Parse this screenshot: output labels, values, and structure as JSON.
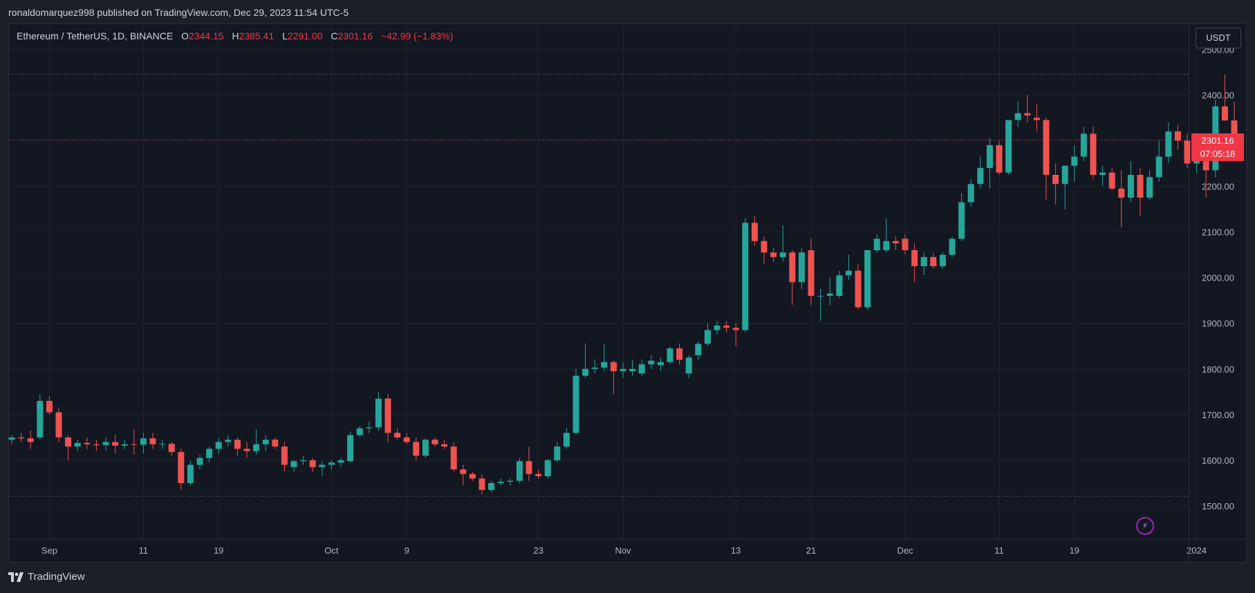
{
  "header": {
    "publisher_line": "ronaldomarquez998 published on TradingView.com, Dec 29, 2023 11:54 UTC-5"
  },
  "symbol": {
    "name": "Ethereum / TetherUS, 1D, BINANCE",
    "open_label": "O",
    "open": "2344.15",
    "high_label": "H",
    "high": "2385.41",
    "low_label": "L",
    "low": "2291.00",
    "close_label": "C",
    "close": "2301.16",
    "change": "−42.99 (−1.83%)"
  },
  "currency_button": {
    "label": "USDT"
  },
  "last_price": {
    "value": "2301.16",
    "countdown": "07:05:18"
  },
  "footer": {
    "brand": "TradingView"
  },
  "icons": {
    "logo": "tradingview-logo-icon",
    "alert": "lightning-bolt-icon"
  },
  "colors": {
    "up": "#26a69a",
    "down": "#ef5350",
    "background": "#131722",
    "grid": "#1e222d",
    "last_price": "#f23645"
  },
  "chart_data": {
    "type": "candlestick",
    "title": "Ethereum / TetherUS, 1D, BINANCE",
    "ylim": [
      1435,
      2510
    ],
    "y_ticks": [
      1500,
      1600,
      1700,
      1800,
      1900,
      2000,
      2100,
      2200,
      2300,
      2400,
      2500
    ],
    "y_tick_labels": [
      "1500.00",
      "1600.00",
      "1700.00",
      "1800.00",
      "1900.00",
      "2000.00",
      "2100.00",
      "2200.00",
      "2300.00",
      "2400.00",
      "2500.00"
    ],
    "x_tick_labels": [
      {
        "label": "Sep",
        "date": "2023-09-01"
      },
      {
        "label": "11",
        "date": "2023-09-11"
      },
      {
        "label": "19",
        "date": "2023-09-19"
      },
      {
        "label": "Oct",
        "date": "2023-10-01"
      },
      {
        "label": "9",
        "date": "2023-10-09"
      },
      {
        "label": "23",
        "date": "2023-10-23"
      },
      {
        "label": "Nov",
        "date": "2023-11-01"
      },
      {
        "label": "13",
        "date": "2023-11-13"
      },
      {
        "label": "21",
        "date": "2023-11-21"
      },
      {
        "label": "Dec",
        "date": "2023-12-01"
      },
      {
        "label": "11",
        "date": "2023-12-11"
      },
      {
        "label": "19",
        "date": "2023-12-19"
      },
      {
        "label": "2024",
        "date": "2024-01-01"
      }
    ],
    "grid": true,
    "horizontal_levels": [
      2445,
      2301.16,
      1521
    ],
    "ohlc": [
      {
        "date": "2023-08-28",
        "o": 1645,
        "h": 1655,
        "l": 1635,
        "c": 1650
      },
      {
        "date": "2023-08-29",
        "o": 1650,
        "h": 1660,
        "l": 1640,
        "c": 1648
      },
      {
        "date": "2023-08-30",
        "o": 1648,
        "h": 1665,
        "l": 1625,
        "c": 1640
      },
      {
        "date": "2023-08-31",
        "o": 1650,
        "h": 1745,
        "l": 1645,
        "c": 1730
      },
      {
        "date": "2023-09-01",
        "o": 1730,
        "h": 1740,
        "l": 1700,
        "c": 1705
      },
      {
        "date": "2023-09-02",
        "o": 1705,
        "h": 1715,
        "l": 1640,
        "c": 1650
      },
      {
        "date": "2023-09-03",
        "o": 1650,
        "h": 1655,
        "l": 1600,
        "c": 1630
      },
      {
        "date": "2023-09-04",
        "o": 1630,
        "h": 1645,
        "l": 1620,
        "c": 1638
      },
      {
        "date": "2023-09-05",
        "o": 1638,
        "h": 1650,
        "l": 1625,
        "c": 1635
      },
      {
        "date": "2023-09-06",
        "o": 1635,
        "h": 1645,
        "l": 1620,
        "c": 1633
      },
      {
        "date": "2023-09-07",
        "o": 1633,
        "h": 1650,
        "l": 1620,
        "c": 1640
      },
      {
        "date": "2023-09-08",
        "o": 1640,
        "h": 1655,
        "l": 1615,
        "c": 1632
      },
      {
        "date": "2023-09-09",
        "o": 1632,
        "h": 1645,
        "l": 1625,
        "c": 1635
      },
      {
        "date": "2023-09-10",
        "o": 1635,
        "h": 1668,
        "l": 1612,
        "c": 1634
      },
      {
        "date": "2023-09-11",
        "o": 1634,
        "h": 1660,
        "l": 1615,
        "c": 1648
      },
      {
        "date": "2023-09-12",
        "o": 1648,
        "h": 1660,
        "l": 1625,
        "c": 1635
      },
      {
        "date": "2023-09-13",
        "o": 1635,
        "h": 1645,
        "l": 1625,
        "c": 1636
      },
      {
        "date": "2023-09-14",
        "o": 1636,
        "h": 1640,
        "l": 1610,
        "c": 1618
      },
      {
        "date": "2023-09-15",
        "o": 1618,
        "h": 1625,
        "l": 1535,
        "c": 1550
      },
      {
        "date": "2023-09-16",
        "o": 1550,
        "h": 1600,
        "l": 1545,
        "c": 1590
      },
      {
        "date": "2023-09-17",
        "o": 1590,
        "h": 1612,
        "l": 1580,
        "c": 1605
      },
      {
        "date": "2023-09-18",
        "o": 1605,
        "h": 1630,
        "l": 1595,
        "c": 1625
      },
      {
        "date": "2023-09-19",
        "o": 1625,
        "h": 1648,
        "l": 1615,
        "c": 1640
      },
      {
        "date": "2023-09-20",
        "o": 1640,
        "h": 1655,
        "l": 1630,
        "c": 1645
      },
      {
        "date": "2023-09-21",
        "o": 1645,
        "h": 1650,
        "l": 1610,
        "c": 1625
      },
      {
        "date": "2023-09-22",
        "o": 1625,
        "h": 1640,
        "l": 1605,
        "c": 1620
      },
      {
        "date": "2023-09-23",
        "o": 1620,
        "h": 1668,
        "l": 1612,
        "c": 1635
      },
      {
        "date": "2023-09-24",
        "o": 1635,
        "h": 1655,
        "l": 1620,
        "c": 1645
      },
      {
        "date": "2023-09-25",
        "o": 1645,
        "h": 1650,
        "l": 1625,
        "c": 1630
      },
      {
        "date": "2023-09-26",
        "o": 1630,
        "h": 1640,
        "l": 1575,
        "c": 1590
      },
      {
        "date": "2023-09-27",
        "o": 1585,
        "h": 1600,
        "l": 1575,
        "c": 1598
      },
      {
        "date": "2023-09-28",
        "o": 1598,
        "h": 1610,
        "l": 1590,
        "c": 1600
      },
      {
        "date": "2023-09-29",
        "o": 1600,
        "h": 1605,
        "l": 1575,
        "c": 1585
      },
      {
        "date": "2023-09-30",
        "o": 1585,
        "h": 1598,
        "l": 1565,
        "c": 1590
      },
      {
        "date": "2023-10-01",
        "o": 1590,
        "h": 1600,
        "l": 1580,
        "c": 1595
      },
      {
        "date": "2023-10-02",
        "o": 1595,
        "h": 1605,
        "l": 1585,
        "c": 1600
      },
      {
        "date": "2023-10-03",
        "o": 1598,
        "h": 1663,
        "l": 1595,
        "c": 1655
      },
      {
        "date": "2023-10-04",
        "o": 1655,
        "h": 1675,
        "l": 1650,
        "c": 1670
      },
      {
        "date": "2023-10-05",
        "o": 1670,
        "h": 1685,
        "l": 1660,
        "c": 1672
      },
      {
        "date": "2023-10-06",
        "o": 1672,
        "h": 1750,
        "l": 1665,
        "c": 1735
      },
      {
        "date": "2023-10-07",
        "o": 1735,
        "h": 1745,
        "l": 1640,
        "c": 1660
      },
      {
        "date": "2023-10-08",
        "o": 1660,
        "h": 1670,
        "l": 1645,
        "c": 1650
      },
      {
        "date": "2023-10-09",
        "o": 1650,
        "h": 1660,
        "l": 1635,
        "c": 1640
      },
      {
        "date": "2023-10-10",
        "o": 1640,
        "h": 1650,
        "l": 1600,
        "c": 1610
      },
      {
        "date": "2023-10-11",
        "o": 1610,
        "h": 1648,
        "l": 1605,
        "c": 1645
      },
      {
        "date": "2023-10-12",
        "o": 1645,
        "h": 1650,
        "l": 1630,
        "c": 1635
      },
      {
        "date": "2023-10-13",
        "o": 1635,
        "h": 1645,
        "l": 1625,
        "c": 1630
      },
      {
        "date": "2023-10-14",
        "o": 1630,
        "h": 1640,
        "l": 1575,
        "c": 1580
      },
      {
        "date": "2023-10-15",
        "o": 1580,
        "h": 1590,
        "l": 1545,
        "c": 1570
      },
      {
        "date": "2023-10-16",
        "o": 1570,
        "h": 1575,
        "l": 1555,
        "c": 1560
      },
      {
        "date": "2023-10-17",
        "o": 1560,
        "h": 1570,
        "l": 1525,
        "c": 1535
      },
      {
        "date": "2023-10-18",
        "o": 1535,
        "h": 1555,
        "l": 1530,
        "c": 1550
      },
      {
        "date": "2023-10-19",
        "o": 1550,
        "h": 1560,
        "l": 1545,
        "c": 1553
      },
      {
        "date": "2023-10-20",
        "o": 1553,
        "h": 1560,
        "l": 1545,
        "c": 1555
      },
      {
        "date": "2023-10-21",
        "o": 1555,
        "h": 1605,
        "l": 1550,
        "c": 1598
      },
      {
        "date": "2023-10-22",
        "o": 1598,
        "h": 1630,
        "l": 1555,
        "c": 1570
      },
      {
        "date": "2023-10-23",
        "o": 1570,
        "h": 1580,
        "l": 1560,
        "c": 1565
      },
      {
        "date": "2023-10-24",
        "o": 1565,
        "h": 1603,
        "l": 1560,
        "c": 1600
      },
      {
        "date": "2023-10-25",
        "o": 1600,
        "h": 1640,
        "l": 1595,
        "c": 1630
      },
      {
        "date": "2023-10-26",
        "o": 1630,
        "h": 1670,
        "l": 1625,
        "c": 1660
      },
      {
        "date": "2023-10-27",
        "o": 1660,
        "h": 1800,
        "l": 1655,
        "c": 1785
      },
      {
        "date": "2023-10-28",
        "o": 1785,
        "h": 1855,
        "l": 1780,
        "c": 1800
      },
      {
        "date": "2023-10-29",
        "o": 1800,
        "h": 1820,
        "l": 1790,
        "c": 1803
      },
      {
        "date": "2023-10-30",
        "o": 1803,
        "h": 1855,
        "l": 1795,
        "c": 1815
      },
      {
        "date": "2023-10-31",
        "o": 1815,
        "h": 1818,
        "l": 1745,
        "c": 1795
      },
      {
        "date": "2023-11-01",
        "o": 1795,
        "h": 1815,
        "l": 1780,
        "c": 1800
      },
      {
        "date": "2023-11-02",
        "o": 1795,
        "h": 1820,
        "l": 1785,
        "c": 1800
      },
      {
        "date": "2023-11-03",
        "o": 1790,
        "h": 1820,
        "l": 1785,
        "c": 1810
      },
      {
        "date": "2023-11-04",
        "o": 1810,
        "h": 1830,
        "l": 1800,
        "c": 1818
      },
      {
        "date": "2023-11-05",
        "o": 1808,
        "h": 1825,
        "l": 1795,
        "c": 1815
      },
      {
        "date": "2023-11-06",
        "o": 1815,
        "h": 1850,
        "l": 1810,
        "c": 1845
      },
      {
        "date": "2023-11-07",
        "o": 1845,
        "h": 1855,
        "l": 1810,
        "c": 1820
      },
      {
        "date": "2023-11-08",
        "o": 1790,
        "h": 1830,
        "l": 1780,
        "c": 1825
      },
      {
        "date": "2023-11-09",
        "o": 1830,
        "h": 1860,
        "l": 1820,
        "c": 1855
      },
      {
        "date": "2023-11-10",
        "o": 1855,
        "h": 1900,
        "l": 1850,
        "c": 1885
      },
      {
        "date": "2023-11-11",
        "o": 1885,
        "h": 1905,
        "l": 1875,
        "c": 1895
      },
      {
        "date": "2023-11-12",
        "o": 1895,
        "h": 1905,
        "l": 1880,
        "c": 1890
      },
      {
        "date": "2023-11-13",
        "o": 1890,
        "h": 1900,
        "l": 1850,
        "c": 1885
      },
      {
        "date": "2023-11-14",
        "o": 1885,
        "h": 2130,
        "l": 1880,
        "c": 2120
      },
      {
        "date": "2023-11-15",
        "o": 2120,
        "h": 2135,
        "l": 2070,
        "c": 2080
      },
      {
        "date": "2023-11-16",
        "o": 2080,
        "h": 2090,
        "l": 2030,
        "c": 2055
      },
      {
        "date": "2023-11-17",
        "o": 2055,
        "h": 2065,
        "l": 2035,
        "c": 2045
      },
      {
        "date": "2023-11-18",
        "o": 2045,
        "h": 2115,
        "l": 2035,
        "c": 2055
      },
      {
        "date": "2023-11-19",
        "o": 2055,
        "h": 2060,
        "l": 1940,
        "c": 1990
      },
      {
        "date": "2023-11-20",
        "o": 1990,
        "h": 2065,
        "l": 1975,
        "c": 2055
      },
      {
        "date": "2023-11-21",
        "o": 2060,
        "h": 2085,
        "l": 1940,
        "c": 1960
      },
      {
        "date": "2023-11-22",
        "o": 1960,
        "h": 1975,
        "l": 1905,
        "c": 1960
      },
      {
        "date": "2023-11-23",
        "o": 1960,
        "h": 2000,
        "l": 1940,
        "c": 1965
      },
      {
        "date": "2023-11-24",
        "o": 1960,
        "h": 2015,
        "l": 1955,
        "c": 2005
      },
      {
        "date": "2023-11-25",
        "o": 2005,
        "h": 2050,
        "l": 1995,
        "c": 2015
      },
      {
        "date": "2023-11-26",
        "o": 2015,
        "h": 2030,
        "l": 1930,
        "c": 1935
      },
      {
        "date": "2023-11-27",
        "o": 1935,
        "h": 2050,
        "l": 1930,
        "c": 2060
      },
      {
        "date": "2023-11-28",
        "o": 2060,
        "h": 2095,
        "l": 2055,
        "c": 2085
      },
      {
        "date": "2023-11-29",
        "o": 2060,
        "h": 2130,
        "l": 2055,
        "c": 2080
      },
      {
        "date": "2023-11-30",
        "o": 2080,
        "h": 2090,
        "l": 2060,
        "c": 2075
      },
      {
        "date": "2023-12-01",
        "o": 2085,
        "h": 2095,
        "l": 2050,
        "c": 2060
      },
      {
        "date": "2023-12-02",
        "o": 2060,
        "h": 2075,
        "l": 1990,
        "c": 2025
      },
      {
        "date": "2023-12-03",
        "o": 2025,
        "h": 2055,
        "l": 2005,
        "c": 2045
      },
      {
        "date": "2023-12-04",
        "o": 2045,
        "h": 2055,
        "l": 2020,
        "c": 2025
      },
      {
        "date": "2023-12-05",
        "o": 2025,
        "h": 2055,
        "l": 2020,
        "c": 2050
      },
      {
        "date": "2023-12-06",
        "o": 2050,
        "h": 2090,
        "l": 2045,
        "c": 2085
      },
      {
        "date": "2023-12-07",
        "o": 2085,
        "h": 2185,
        "l": 2080,
        "c": 2165
      },
      {
        "date": "2023-12-08",
        "o": 2165,
        "h": 2215,
        "l": 2155,
        "c": 2205
      },
      {
        "date": "2023-12-09",
        "o": 2205,
        "h": 2265,
        "l": 2195,
        "c": 2240
      },
      {
        "date": "2023-12-10",
        "o": 2240,
        "h": 2305,
        "l": 2195,
        "c": 2290
      },
      {
        "date": "2023-12-11",
        "o": 2290,
        "h": 2300,
        "l": 2225,
        "c": 2230
      },
      {
        "date": "2023-12-12",
        "o": 2230,
        "h": 2320,
        "l": 2225,
        "c": 2345
      },
      {
        "date": "2023-12-13",
        "o": 2345,
        "h": 2385,
        "l": 2330,
        "c": 2360
      },
      {
        "date": "2023-12-14",
        "o": 2360,
        "h": 2400,
        "l": 2340,
        "c": 2355
      },
      {
        "date": "2023-12-15",
        "o": 2350,
        "h": 2380,
        "l": 2320,
        "c": 2345
      },
      {
        "date": "2023-12-16",
        "o": 2345,
        "h": 2350,
        "l": 2170,
        "c": 2225
      },
      {
        "date": "2023-12-17",
        "o": 2225,
        "h": 2250,
        "l": 2160,
        "c": 2205
      },
      {
        "date": "2023-12-18",
        "o": 2205,
        "h": 2230,
        "l": 2150,
        "c": 2245
      },
      {
        "date": "2023-12-19",
        "o": 2245,
        "h": 2290,
        "l": 2210,
        "c": 2265
      },
      {
        "date": "2023-12-20",
        "o": 2265,
        "h": 2330,
        "l": 2255,
        "c": 2315
      },
      {
        "date": "2023-12-21",
        "o": 2315,
        "h": 2330,
        "l": 2215,
        "c": 2225
      },
      {
        "date": "2023-12-22",
        "o": 2225,
        "h": 2245,
        "l": 2200,
        "c": 2230
      },
      {
        "date": "2023-12-23",
        "o": 2230,
        "h": 2240,
        "l": 2190,
        "c": 2195
      },
      {
        "date": "2023-12-24",
        "o": 2195,
        "h": 2235,
        "l": 2110,
        "c": 2175
      },
      {
        "date": "2023-12-25",
        "o": 2175,
        "h": 2255,
        "l": 2165,
        "c": 2225
      },
      {
        "date": "2023-12-26",
        "o": 2225,
        "h": 2240,
        "l": 2135,
        "c": 2175
      },
      {
        "date": "2023-12-27",
        "o": 2175,
        "h": 2235,
        "l": 2170,
        "c": 2220
      },
      {
        "date": "2023-12-28",
        "o": 2220,
        "h": 2300,
        "l": 2210,
        "c": 2265
      },
      {
        "date": "2023-12-29",
        "o": 2265,
        "h": 2340,
        "l": 2250,
        "c": 2320
      },
      {
        "date": "2023-12-30",
        "o": 2320,
        "h": 2335,
        "l": 2280,
        "c": 2300
      },
      {
        "date": "2023-12-31",
        "o": 2300,
        "h": 2315,
        "l": 2240,
        "c": 2250
      },
      {
        "date": "2024-01-01",
        "o": 2250,
        "h": 2310,
        "l": 2230,
        "c": 2265
      },
      {
        "date": "2024-01-02",
        "o": 2255,
        "h": 2275,
        "l": 2175,
        "c": 2235
      },
      {
        "date": "2024-01-03",
        "o": 2235,
        "h": 2390,
        "l": 2220,
        "c": 2375
      },
      {
        "date": "2024-01-04",
        "o": 2375,
        "h": 2445,
        "l": 2345,
        "c": 2344
      },
      {
        "date": "2024-01-05",
        "o": 2344.15,
        "h": 2385.41,
        "l": 2291,
        "c": 2301.16
      }
    ]
  }
}
